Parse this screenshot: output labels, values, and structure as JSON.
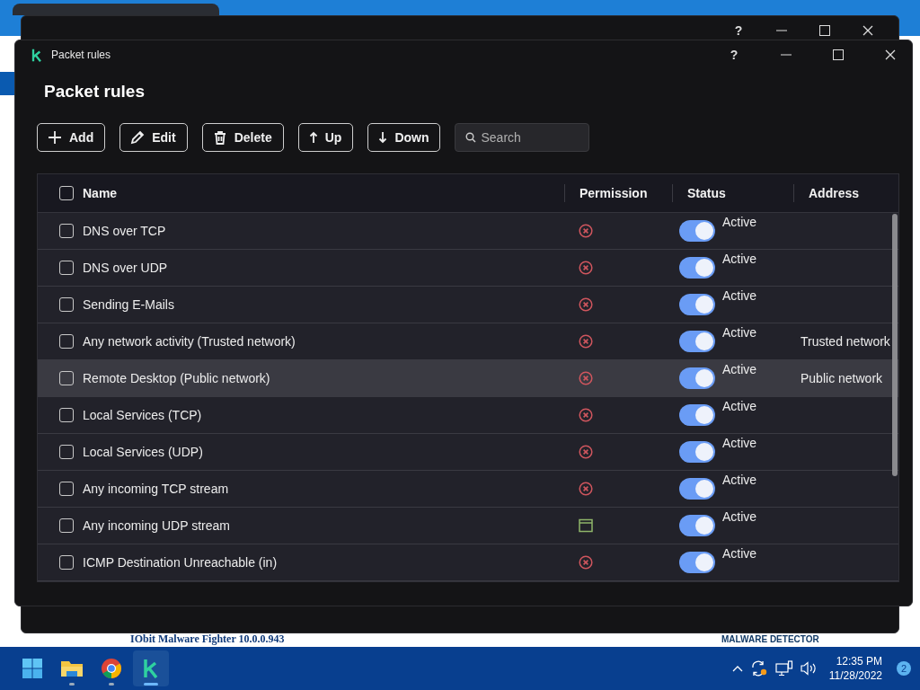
{
  "browser": {
    "page_heading": "IObit Malware Fighter 10.0.0.943",
    "section_label": "MALWARE DETECTOR"
  },
  "back_window": {
    "help": "?"
  },
  "window": {
    "title": "Packet rules",
    "help": "?"
  },
  "heading": "Packet rules",
  "toolbar": [
    {
      "kind": "add",
      "label": "Add"
    },
    {
      "kind": "edit",
      "label": "Edit"
    },
    {
      "kind": "delete",
      "label": "Delete"
    },
    {
      "kind": "up",
      "label": "Up"
    },
    {
      "kind": "down",
      "label": "Down"
    }
  ],
  "search": {
    "placeholder": "Search"
  },
  "table": {
    "select_all_checked": false,
    "columns": [
      "Name",
      "Permission",
      "Status",
      "Address"
    ],
    "rows": [
      {
        "name": "DNS over TCP",
        "checked": false,
        "selected": false,
        "kind": "blocked",
        "on": true,
        "status": "Active"
      },
      {
        "name": "DNS over UDP",
        "checked": false,
        "selected": false,
        "kind": "blocked",
        "on": true,
        "status": "Active"
      },
      {
        "name": "Sending E-Mails",
        "checked": false,
        "selected": false,
        "kind": "blocked",
        "on": true,
        "status": "Active"
      },
      {
        "name": "Any network activity (Trusted network)",
        "checked": false,
        "selected": false,
        "kind": "blocked",
        "on": true,
        "status": "Active",
        "address": "Trusted network"
      },
      {
        "name": "Remote Desktop (Public network)",
        "checked": false,
        "selected": true,
        "kind": "blocked",
        "on": true,
        "status": "Active",
        "address": "Public network"
      },
      {
        "name": "Local Services (TCP)",
        "checked": false,
        "selected": false,
        "kind": "blocked",
        "on": true,
        "status": "Active"
      },
      {
        "name": "Local Services (UDP)",
        "checked": false,
        "selected": false,
        "kind": "blocked",
        "on": true,
        "status": "Active"
      },
      {
        "name": "Any incoming TCP stream",
        "checked": false,
        "selected": false,
        "kind": "blocked",
        "on": true,
        "status": "Active"
      },
      {
        "name": "Any incoming UDP stream",
        "checked": false,
        "selected": false,
        "kind": "app",
        "on": true,
        "status": "Active"
      },
      {
        "name": "ICMP Destination Unreachable (in)",
        "checked": false,
        "selected": false,
        "kind": "blocked",
        "on": true,
        "status": "Active"
      }
    ]
  },
  "taskbar": {
    "apps": [
      {
        "kind": "folder",
        "selected": false
      },
      {
        "kind": "chrome",
        "selected": false
      },
      {
        "kind": "kaspersky",
        "selected": true
      }
    ],
    "time": "12:35 PM",
    "date": "11/28/2022",
    "notifications": "2"
  }
}
